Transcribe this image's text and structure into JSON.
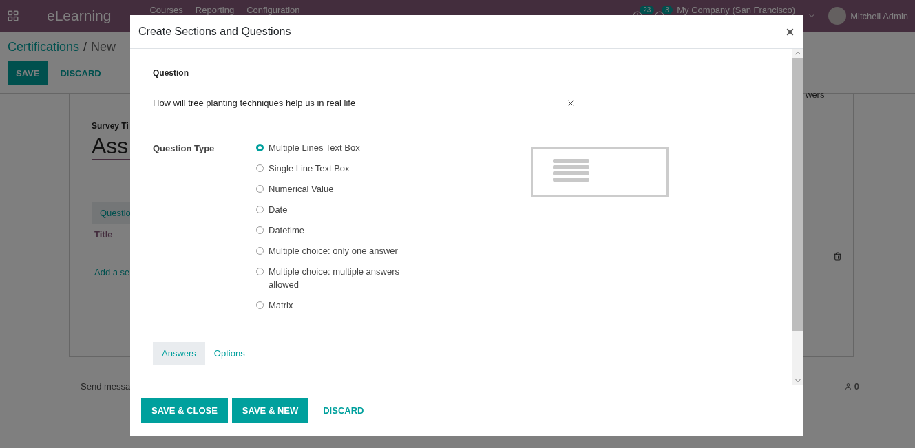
{
  "navbar": {
    "app_name": "eLearning",
    "menu": [
      "Courses",
      "Reporting",
      "Configuration"
    ],
    "activity_count": "23",
    "message_count": "3",
    "company": "My Company (San Francisco)",
    "user": "Mitchell Admin"
  },
  "control_panel": {
    "breadcrumb": [
      "Certifications",
      "New"
    ],
    "separator": "/",
    "save": "SAVE",
    "discard": "DISCARD"
  },
  "form": {
    "title_label": "Survey Ti",
    "title_value": "Ass",
    "tab": "Questio",
    "column_1": "Title",
    "column_2": "wers",
    "add_line": "Add a se"
  },
  "chatter": {
    "send_message": "Send messa",
    "followers": "0"
  },
  "dialog": {
    "title": "Create Sections and Questions",
    "question_label": "Question",
    "question_value": "How will tree planting techniques help us in real life",
    "question_type_label": "Question Type",
    "question_types": [
      {
        "label": "Multiple Lines Text Box",
        "selected": true
      },
      {
        "label": "Single Line Text Box",
        "selected": false
      },
      {
        "label": "Numerical Value",
        "selected": false
      },
      {
        "label": "Date",
        "selected": false
      },
      {
        "label": "Datetime",
        "selected": false
      },
      {
        "label": "Multiple choice: only one answer",
        "selected": false
      },
      {
        "label": "Multiple choice: multiple answers allowed",
        "selected": false
      },
      {
        "label": "Matrix",
        "selected": false
      }
    ],
    "tabs": [
      {
        "label": "Answers",
        "selected": true
      },
      {
        "label": "Options",
        "selected": false
      }
    ],
    "buttons": [
      {
        "label": "SAVE & CLOSE",
        "kind": "primary"
      },
      {
        "label": "SAVE & NEW",
        "kind": "primary"
      },
      {
        "label": "DISCARD",
        "kind": "link"
      }
    ]
  }
}
